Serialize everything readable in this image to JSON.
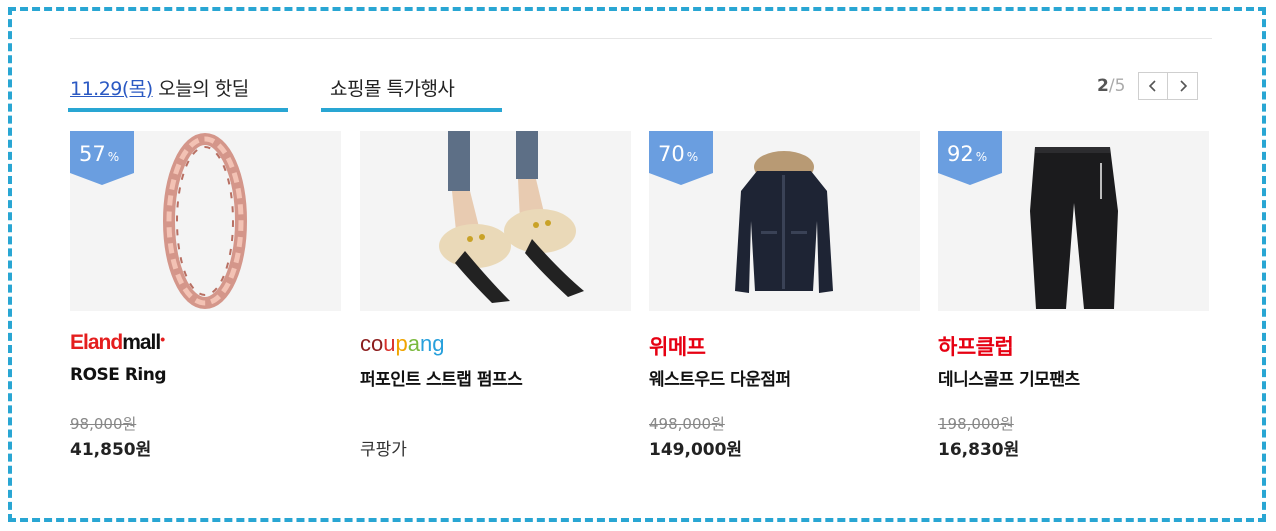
{
  "tabs": {
    "today_date": "11.29(목)",
    "today_label": " 오늘의 핫딜",
    "event_label": "쇼핑몰 특가행사"
  },
  "pager": {
    "current": "2",
    "separator": "/",
    "total": "5"
  },
  "colors": {
    "accent": "#29a6d3",
    "badge": "#6a9ee0",
    "link_blue": "#2b59c3",
    "brand_red": "#e60012"
  },
  "products": [
    {
      "badge_value": "57",
      "badge_unit": "%",
      "brand": "Elandmall",
      "brand_part1": "Eland",
      "brand_part2": "mall",
      "brand_dot": "•",
      "name": "ROSE Ring",
      "original_price": "98,000원",
      "price": "41,850원",
      "image": "rose-gold-ring"
    },
    {
      "brand": "coupang",
      "brand_letters": [
        "c",
        "o",
        "u",
        "p",
        "a",
        "n",
        "g"
      ],
      "name": "퍼포인트 스트랩 펌프스",
      "original_price": "",
      "price": "쿠팡가",
      "image": "fur-mule-shoes"
    },
    {
      "badge_value": "70",
      "badge_unit": "%",
      "brand": "위메프",
      "name": "웨스트우드 다운점퍼",
      "original_price": "498,000원",
      "price": "149,000원",
      "image": "navy-down-jacket"
    },
    {
      "badge_value": "92",
      "badge_unit": "%",
      "brand": "하프클럽",
      "name": "데니스골프 기모팬츠",
      "original_price": "198,000원",
      "price": "16,830원",
      "image": "black-pants"
    }
  ]
}
